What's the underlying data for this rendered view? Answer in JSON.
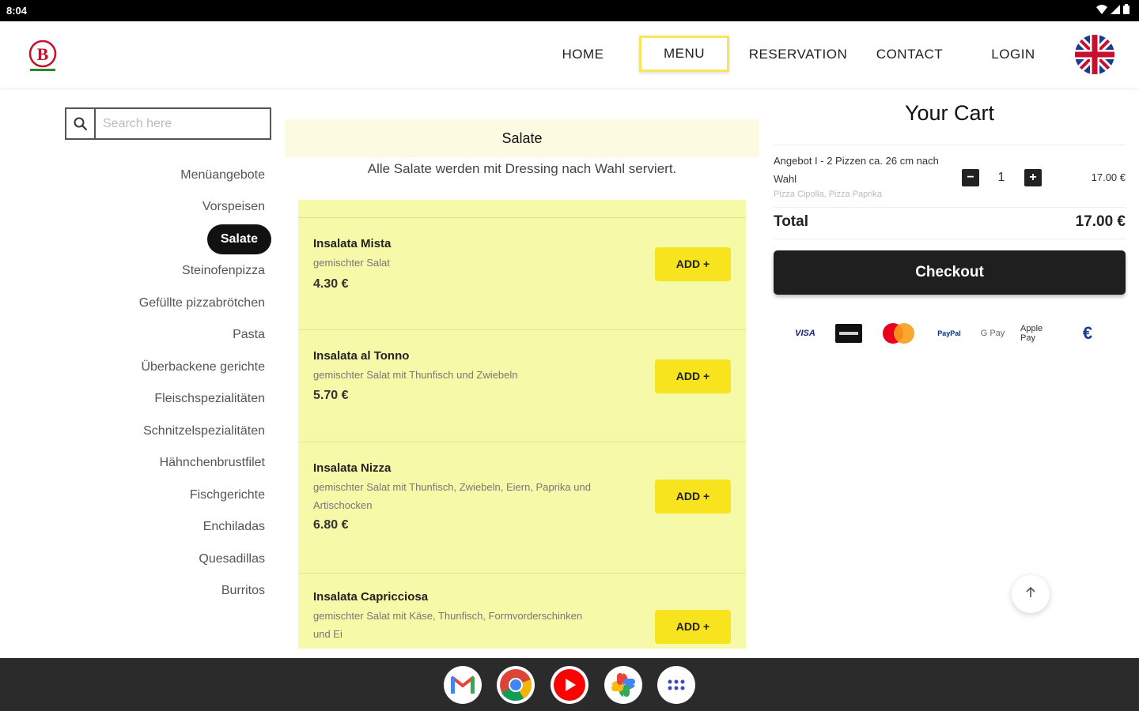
{
  "status_bar": {
    "time": "8:04"
  },
  "header": {
    "logo_letter": "B",
    "nav": {
      "home": "HOME",
      "menu": "MENU",
      "reservation": "RESERVATION",
      "contact": "CONTACT",
      "login": "LOGIN"
    },
    "language": "English"
  },
  "sidebar": {
    "search_placeholder": "Search here",
    "categories": [
      {
        "label": "Menüangebote"
      },
      {
        "label": "Vorspeisen"
      },
      {
        "label": "Salate",
        "active": true
      },
      {
        "label": "Steinofenpizza"
      },
      {
        "label": "Gefüllte pizzabrötchen"
      },
      {
        "label": "Pasta"
      },
      {
        "label": "Überbackene gerichte"
      },
      {
        "label": "Fleischspezialitäten"
      },
      {
        "label": "Schnitzelspezialitäten"
      },
      {
        "label": "Hähnchenbrustfilet"
      },
      {
        "label": "Fischgerichte"
      },
      {
        "label": "Enchiladas"
      },
      {
        "label": "Quesadillas"
      },
      {
        "label": "Burritos"
      }
    ]
  },
  "main": {
    "category_title": "Salate",
    "category_description": "Alle Salate werden mit Dressing nach Wahl serviert.",
    "add_label": "ADD +",
    "products": [
      {
        "name": "Insalata Mista",
        "description": "gemischter Salat",
        "price": "4.30 €"
      },
      {
        "name": "Insalata al Tonno",
        "description": "gemischter Salat mit Thunfisch und Zwiebeln",
        "price": "5.70 €"
      },
      {
        "name": "Insalata Nizza",
        "description": "gemischter Salat mit Thunfisch, Zwiebeln, Eiern, Paprika und Artischocken",
        "price": "6.80 €"
      },
      {
        "name": "Insalata Capricciosa",
        "description": "gemischter Salat mit Käse, Thunfisch, Formvorderschinken und Ei",
        "price": ""
      }
    ]
  },
  "cart": {
    "title": "Your Cart",
    "items": [
      {
        "name": "Angebot I - 2 Pizzen ca. 26 cm nach Wahl",
        "details": "Pizza Cipolla, Pizza Paprika",
        "quantity": "1",
        "minus": "−",
        "plus": "+",
        "price": "17.00 €"
      }
    ],
    "total_label": "Total",
    "total_value": "17.00 €",
    "checkout_label": "Checkout",
    "payment_methods": [
      "VISA",
      "Amex",
      "Mastercard",
      "PayPal",
      "G Pay",
      "Apple Pay",
      "€"
    ]
  },
  "colors": {
    "accent_yellow": "#f7e31e",
    "products_bg": "#f6f9a8",
    "banner_bg": "#fcfae0",
    "dark": "#1f1f1f"
  },
  "taskbar": {
    "apps": [
      "gmail-icon",
      "chrome-icon",
      "youtube-icon",
      "photos-icon",
      "app-drawer-icon"
    ]
  }
}
